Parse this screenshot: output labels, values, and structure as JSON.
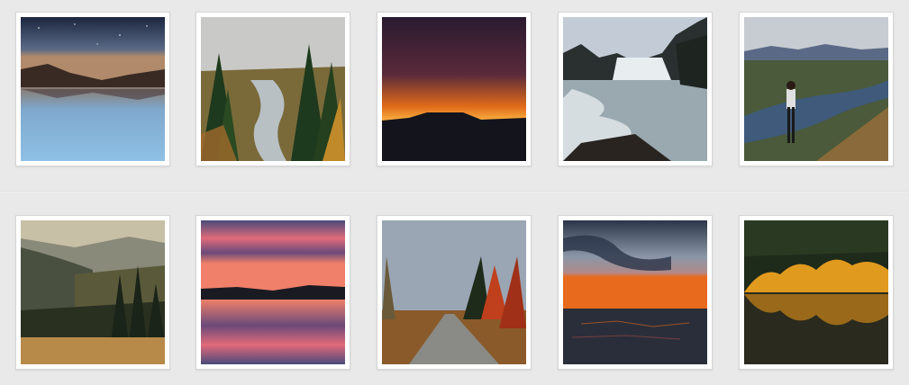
{
  "gallery": {
    "rows": [
      {
        "tiles": [
          {
            "scene": "starry-lake-reflection",
            "colors": {
              "sky": "#2b3550",
              "water": "#7fb3dc"
            }
          },
          {
            "scene": "forest-river-canyon",
            "colors": {
              "sky": "#c9c9c7",
              "trees": "#1f3a20"
            }
          },
          {
            "scene": "orange-sunset-silhouette",
            "colors": {
              "sky": "#3a1e3a",
              "glow": "#f08a1c"
            }
          },
          {
            "scene": "waterfall-rapids",
            "colors": {
              "sky": "#c3ccd6",
              "water": "#dfe6ea"
            }
          },
          {
            "scene": "hiker-valley-view",
            "colors": {
              "sky": "#c7ccd2",
              "water": "#3f5a7a"
            }
          }
        ]
      },
      {
        "tiles": [
          {
            "scene": "misty-hills-forest",
            "colors": {
              "sky": "#c8c0a6",
              "ground": "#b88a4a"
            }
          },
          {
            "scene": "pink-sunset-lake",
            "colors": {
              "sky": "#6a4a7a",
              "glow": "#e06a7a"
            }
          },
          {
            "scene": "autumn-gravel-road",
            "colors": {
              "sky": "#9aa6b4",
              "leaves": "#c0401e"
            }
          },
          {
            "scene": "stormy-sea-sunset",
            "colors": {
              "sky": "#3b4658",
              "glow": "#e86a1c"
            }
          },
          {
            "scene": "golden-forest-reflection",
            "colors": {
              "trees": "#e09a1e",
              "water": "#2a2a1e"
            }
          }
        ]
      }
    ]
  }
}
